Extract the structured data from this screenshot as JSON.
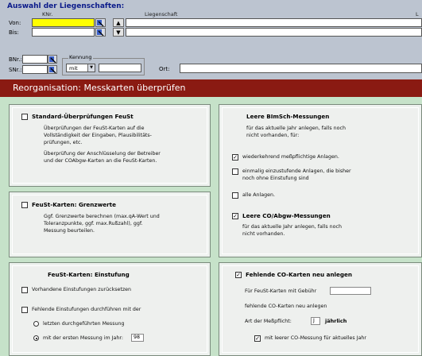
{
  "selection": {
    "title": "Auswahl der Liegenschaften:",
    "col_knr": "KNr.",
    "col_liegenschaft": "Liegenschaft",
    "col_right": "L",
    "von_label": "Von:",
    "bis_label": "Bis:",
    "bnr_label": "BNr.:",
    "snr_label": "SNr.:",
    "kennung_label": "Kennung",
    "kennung_value": "mit",
    "ort_label": "Ort:"
  },
  "header": {
    "title": "Reorganisation: Messkarten überprüfen"
  },
  "panel_standard": {
    "heading": "Standard-Überprüfungen FeuSt",
    "text1": "Überprüfungen der FeuSt-Karten auf die Vollständigkeit der Eingaben, Plausibilitäts-prüfungen, etc.",
    "text2": "Überprüfung der Anschlüsselung der Betreiber und der COAbgw-Karten an die FeuSt-Karten."
  },
  "panel_grenzwerte": {
    "heading": "FeuSt-Karten: Grenzwerte",
    "text": "Ggf. Grenzwerte berechnen (max.qA-Wert und Toleranzpunkte, ggf. max.Rußzahl), ggf. Messung beurteilen."
  },
  "panel_einstufung": {
    "heading": "FeuSt-Karten: Einstufung",
    "opt1": "Vorhandene Einstufungen zurücksetzen",
    "opt2": "Fehlende Einstufungen durchführen mit der",
    "radio1": "letzten durchgeführten Messung",
    "radio2": "mit der ersten Messung im Jahr:",
    "year": "98"
  },
  "panel_blmsch": {
    "heading": "Leere BImSch-Messungen",
    "intro": "für das aktuelle Jahr anlegen, falls noch nicht vorhanden, für:",
    "opt1": "wiederkehrend meßpflichtige Anlagen.",
    "opt2": "einmalig einzustufende Anlagen, die bisher noch ohne Einstufung sind",
    "opt3": "alle Anlagen.",
    "co_heading": "Leere CO/Abgw-Messungen",
    "co_text": "für das aktuelle Jahr anlegen, falls noch nicht vorhanden."
  },
  "panel_co": {
    "heading": "Fehlende CO-Karten neu anlegen",
    "line1": "Für FeuSt-Karten mit Gebühr",
    "line2": "fehlende CO-Karten neu anlegen",
    "line3": "Art der Meßpflicht:",
    "art_value": "J",
    "art_suffix": "jährlich",
    "opt": "mit leerer CO-Messung für aktuelles Jahr"
  },
  "check_mark": "✓",
  "colors": {
    "header_bg": "#8a1a12",
    "main_bg": "#c6e2c9",
    "highlight": "#ffff00"
  }
}
